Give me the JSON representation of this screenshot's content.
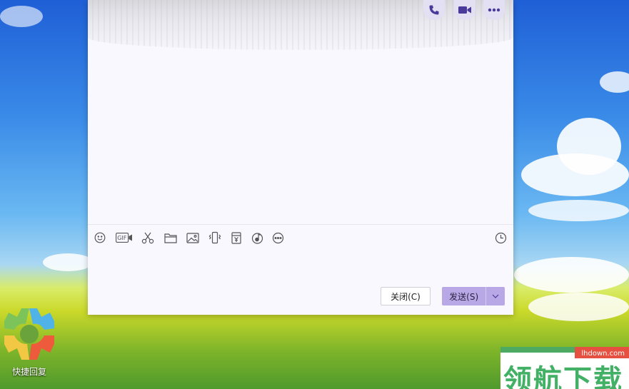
{
  "desktop": {
    "shortcut_label": "快捷回复",
    "shortcut_icon": "quick-reply-icon"
  },
  "chat": {
    "header_buttons": [
      {
        "icon": "phone-icon"
      },
      {
        "icon": "video-call-icon"
      },
      {
        "icon": "more-icon"
      }
    ],
    "toolbar": [
      {
        "icon": "emoji-icon"
      },
      {
        "icon": "gif-icon",
        "text": "GIF"
      },
      {
        "icon": "scissors-icon"
      },
      {
        "icon": "folder-icon"
      },
      {
        "icon": "image-icon"
      },
      {
        "icon": "shake-icon"
      },
      {
        "icon": "red-packet-icon"
      },
      {
        "icon": "music-icon"
      },
      {
        "icon": "more-tools-icon"
      },
      {
        "icon": "history-clock-icon"
      }
    ],
    "close_button": "关闭(C)",
    "send_button": "发送(S)"
  },
  "watermark": {
    "url": "lhdown.com",
    "text": "领航下载"
  },
  "colors": {
    "accent": "#b9a8e6",
    "icon": "#4a3a99",
    "window_bg": "#f9f8ff"
  }
}
